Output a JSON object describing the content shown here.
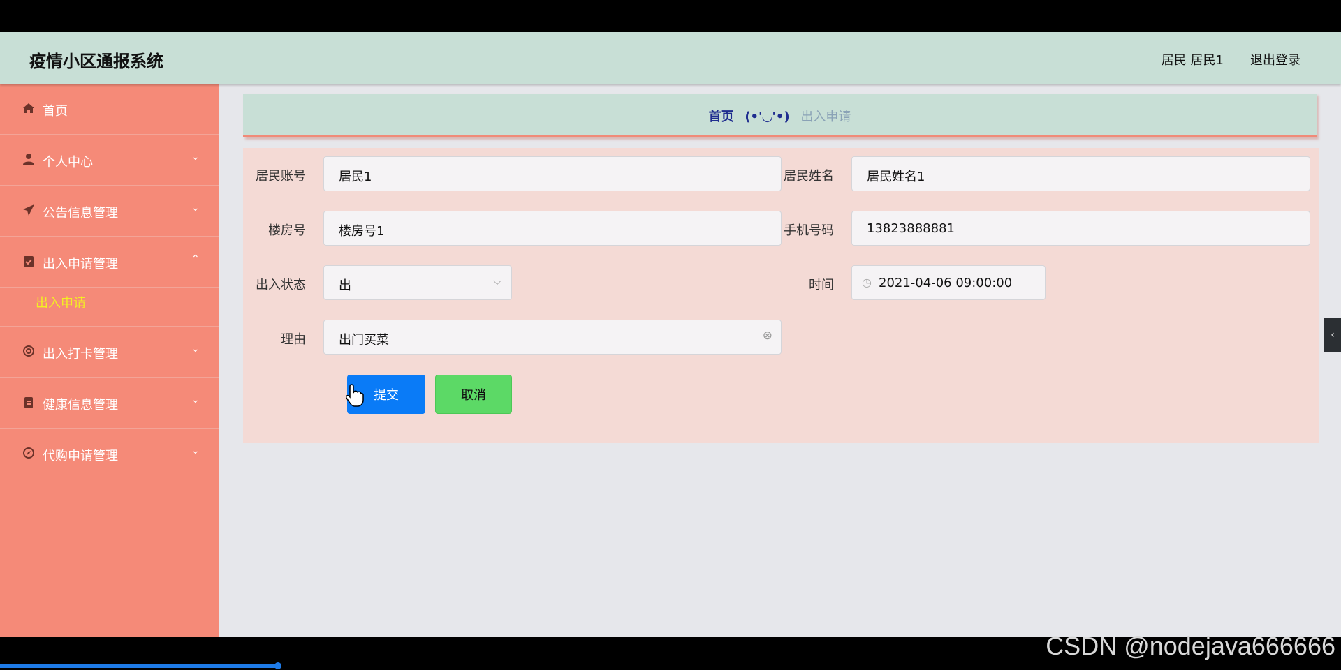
{
  "app": {
    "title": "疫情小区通报系统",
    "user": "居民 居民1",
    "logout": "退出登录"
  },
  "sidebar": {
    "items": [
      {
        "label": "首页",
        "icon": "home-icon"
      },
      {
        "label": "个人中心",
        "icon": "user-icon",
        "chevron": "⌄"
      },
      {
        "label": "公告信息管理",
        "icon": "send-icon",
        "chevron": "⌄"
      },
      {
        "label": "出入申请管理",
        "icon": "clipboard-check-icon",
        "chevron": "⌃"
      },
      {
        "label": "出入打卡管理",
        "icon": "lifebuoy-icon",
        "chevron": "⌄"
      },
      {
        "label": "健康信息管理",
        "icon": "clipboard-icon",
        "chevron": "⌄"
      },
      {
        "label": "代购申请管理",
        "icon": "compass-icon",
        "chevron": "⌄"
      }
    ],
    "active_sub": "出入申请"
  },
  "breadcrumb": {
    "home": "首页",
    "separator": "(•'◡'•)",
    "current": "出入申请"
  },
  "form": {
    "account_label": "居民账号",
    "account_value": "居民1",
    "name_label": "居民姓名",
    "name_value": "居民姓名1",
    "building_label": "楼房号",
    "building_value": "楼房号1",
    "phone_label": "手机号码",
    "phone_value": "13823888881",
    "status_label": "出入状态",
    "status_value": "出",
    "time_label": "时间",
    "time_value": "2021-04-06 09:00:00",
    "reason_label": "理由",
    "reason_value": "出门买菜"
  },
  "buttons": {
    "submit": "提交",
    "cancel": "取消"
  },
  "watermark": "CSDN @nodejava666666",
  "video_progress": 0.207,
  "colors": {
    "header": "#c8dfd6",
    "sidebar": "#f58a78",
    "submenu_active": "#f3ef22",
    "submit": "#0a7bf7",
    "cancel": "#5cd966",
    "panel": "#f4dad5"
  }
}
